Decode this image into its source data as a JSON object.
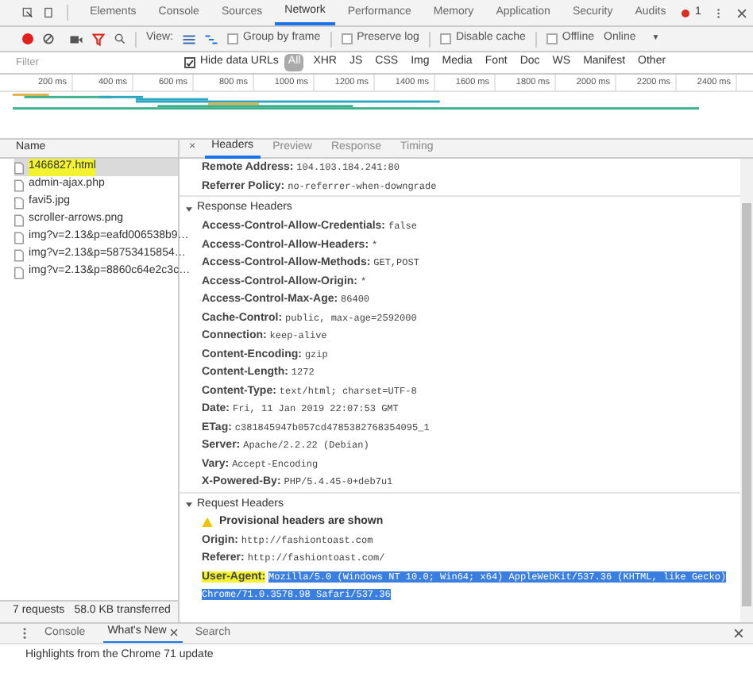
{
  "panel_tabs": [
    {
      "label": "Elements",
      "selected": false
    },
    {
      "label": "Console",
      "selected": false
    },
    {
      "label": "Sources",
      "selected": false
    },
    {
      "label": "Network",
      "selected": true
    },
    {
      "label": "Performance",
      "selected": false
    },
    {
      "label": "Memory",
      "selected": false
    },
    {
      "label": "Application",
      "selected": false
    },
    {
      "label": "Security",
      "selected": false
    },
    {
      "label": "Audits",
      "selected": false
    }
  ],
  "error_count": "1",
  "toolbar": {
    "recording": true,
    "view_label": "View:",
    "checkboxes": [
      {
        "label": "Group by frame",
        "checked": false
      },
      {
        "label": "Preserve log",
        "checked": false
      },
      {
        "label": "Disable cache",
        "checked": false
      },
      {
        "label": "Offline",
        "checked": false
      }
    ],
    "throttle": "Online",
    "throttle_caret": "▼"
  },
  "filter": {
    "placeholder": "Filter",
    "hide_data_urls": {
      "label": "Hide data URLs",
      "checked": true
    },
    "types": [
      {
        "label": "All",
        "selected": true
      },
      {
        "label": "XHR",
        "selected": false
      },
      {
        "label": "JS",
        "selected": false
      },
      {
        "label": "CSS",
        "selected": false
      },
      {
        "label": "Img",
        "selected": false
      },
      {
        "label": "Media",
        "selected": false
      },
      {
        "label": "Font",
        "selected": false
      },
      {
        "label": "Doc",
        "selected": false
      },
      {
        "label": "WS",
        "selected": false
      },
      {
        "label": "Manifest",
        "selected": false
      },
      {
        "label": "Other",
        "selected": false
      }
    ]
  },
  "timeline_ticks": [
    "200 ms",
    "400 ms",
    "600 ms",
    "800 ms",
    "1000 ms",
    "1200 ms",
    "1400 ms",
    "1600 ms",
    "1800 ms",
    "2000 ms",
    "2200 ms",
    "2400 ms"
  ],
  "requests": {
    "column": "Name",
    "rows": [
      {
        "name": "1466827.html",
        "selected": true,
        "highlighted": true
      },
      {
        "name": "admin-ajax.php",
        "selected": false,
        "highlighted": false
      },
      {
        "name": "favi5.jpg",
        "selected": false,
        "highlighted": false
      },
      {
        "name": "scroller-arrows.png",
        "selected": false,
        "highlighted": false
      },
      {
        "name": "img?v=2.13&p=eafd006538b9…",
        "selected": false,
        "highlighted": false
      },
      {
        "name": "img?v=2.13&p=58753415854…",
        "selected": false,
        "highlighted": false
      },
      {
        "name": "img?v=2.13&p=8860c64e2c3c…",
        "selected": false,
        "highlighted": false
      }
    ]
  },
  "status": {
    "requests": "7 requests",
    "transferred": "58.0 KB transferred"
  },
  "detail_close": "×",
  "detail_tabs": [
    {
      "label": "Headers",
      "selected": true
    },
    {
      "label": "Preview",
      "selected": false
    },
    {
      "label": "Response",
      "selected": false
    },
    {
      "label": "Timing",
      "selected": false
    }
  ],
  "sections": [
    {
      "rows": [
        {
          "kind": "header",
          "key": "Remote Address:",
          "value": "104.103.184.241:80",
          "highlighted": false,
          "selected": false
        },
        {
          "kind": "header",
          "key": "Referrer Policy:",
          "value": "no-referrer-when-downgrade",
          "highlighted": false,
          "selected": false
        }
      ]
    },
    {
      "title": "Response Headers",
      "expanded": true,
      "rows": [
        {
          "kind": "header",
          "key": "Access-Control-Allow-Credentials:",
          "value": "false",
          "highlighted": false,
          "selected": false
        },
        {
          "kind": "header",
          "key": "Access-Control-Allow-Headers:",
          "value": "*",
          "highlighted": false,
          "selected": false
        },
        {
          "kind": "header",
          "key": "Access-Control-Allow-Methods:",
          "value": "GET,POST",
          "highlighted": false,
          "selected": false
        },
        {
          "kind": "header",
          "key": "Access-Control-Allow-Origin:",
          "value": "*",
          "highlighted": false,
          "selected": false
        },
        {
          "kind": "header",
          "key": "Access-Control-Max-Age:",
          "value": "86400",
          "highlighted": false,
          "selected": false
        },
        {
          "kind": "header",
          "key": "Cache-Control:",
          "value": "public, max-age=2592000",
          "highlighted": false,
          "selected": false
        },
        {
          "kind": "header",
          "key": "Connection:",
          "value": "keep-alive",
          "highlighted": false,
          "selected": false
        },
        {
          "kind": "header",
          "key": "Content-Encoding:",
          "value": "gzip",
          "highlighted": false,
          "selected": false
        },
        {
          "kind": "header",
          "key": "Content-Length:",
          "value": "1272",
          "highlighted": false,
          "selected": false
        },
        {
          "kind": "header",
          "key": "Content-Type:",
          "value": "text/html; charset=UTF-8",
          "highlighted": false,
          "selected": false
        },
        {
          "kind": "header",
          "key": "Date:",
          "value": "Fri, 11 Jan 2019 22:07:53 GMT",
          "highlighted": false,
          "selected": false
        },
        {
          "kind": "header",
          "key": "ETag:",
          "value": "c381845947b057cd4785382768354095_1",
          "highlighted": false,
          "selected": false
        },
        {
          "kind": "header",
          "key": "Server:",
          "value": "Apache/2.2.22 (Debian)",
          "highlighted": false,
          "selected": false
        },
        {
          "kind": "header",
          "key": "Vary:",
          "value": "Accept-Encoding",
          "highlighted": false,
          "selected": false
        },
        {
          "kind": "header",
          "key": "X-Powered-By:",
          "value": "PHP/5.4.45-0+deb7u1",
          "highlighted": false,
          "selected": false
        }
      ]
    },
    {
      "title": "Request Headers",
      "expanded": true,
      "rows": [
        {
          "kind": "warning",
          "key": "Provisional headers are shown"
        },
        {
          "kind": "header",
          "key": "Origin:",
          "value": "http://fashiontoast.com",
          "highlighted": false,
          "selected": false
        },
        {
          "kind": "header",
          "key": "Referer:",
          "value": "http://fashiontoast.com/",
          "highlighted": false,
          "selected": false
        },
        {
          "kind": "header",
          "key": "User-Agent:",
          "value": "Mozilla/5.0 (Windows NT 10.0; Win64; x64) AppleWebKit/537.36 (KHTML, like Gecko) Chrome/71.0.3578.98 Safari/537.36",
          "highlighted": true,
          "selected": true
        }
      ]
    }
  ],
  "drawer": {
    "tabs": [
      {
        "label": "Console",
        "selected": false,
        "closable": false
      },
      {
        "label": "What's New",
        "selected": true,
        "closable": true
      }
    ],
    "search": "Search",
    "content": "Highlights from the Chrome 71 update"
  }
}
